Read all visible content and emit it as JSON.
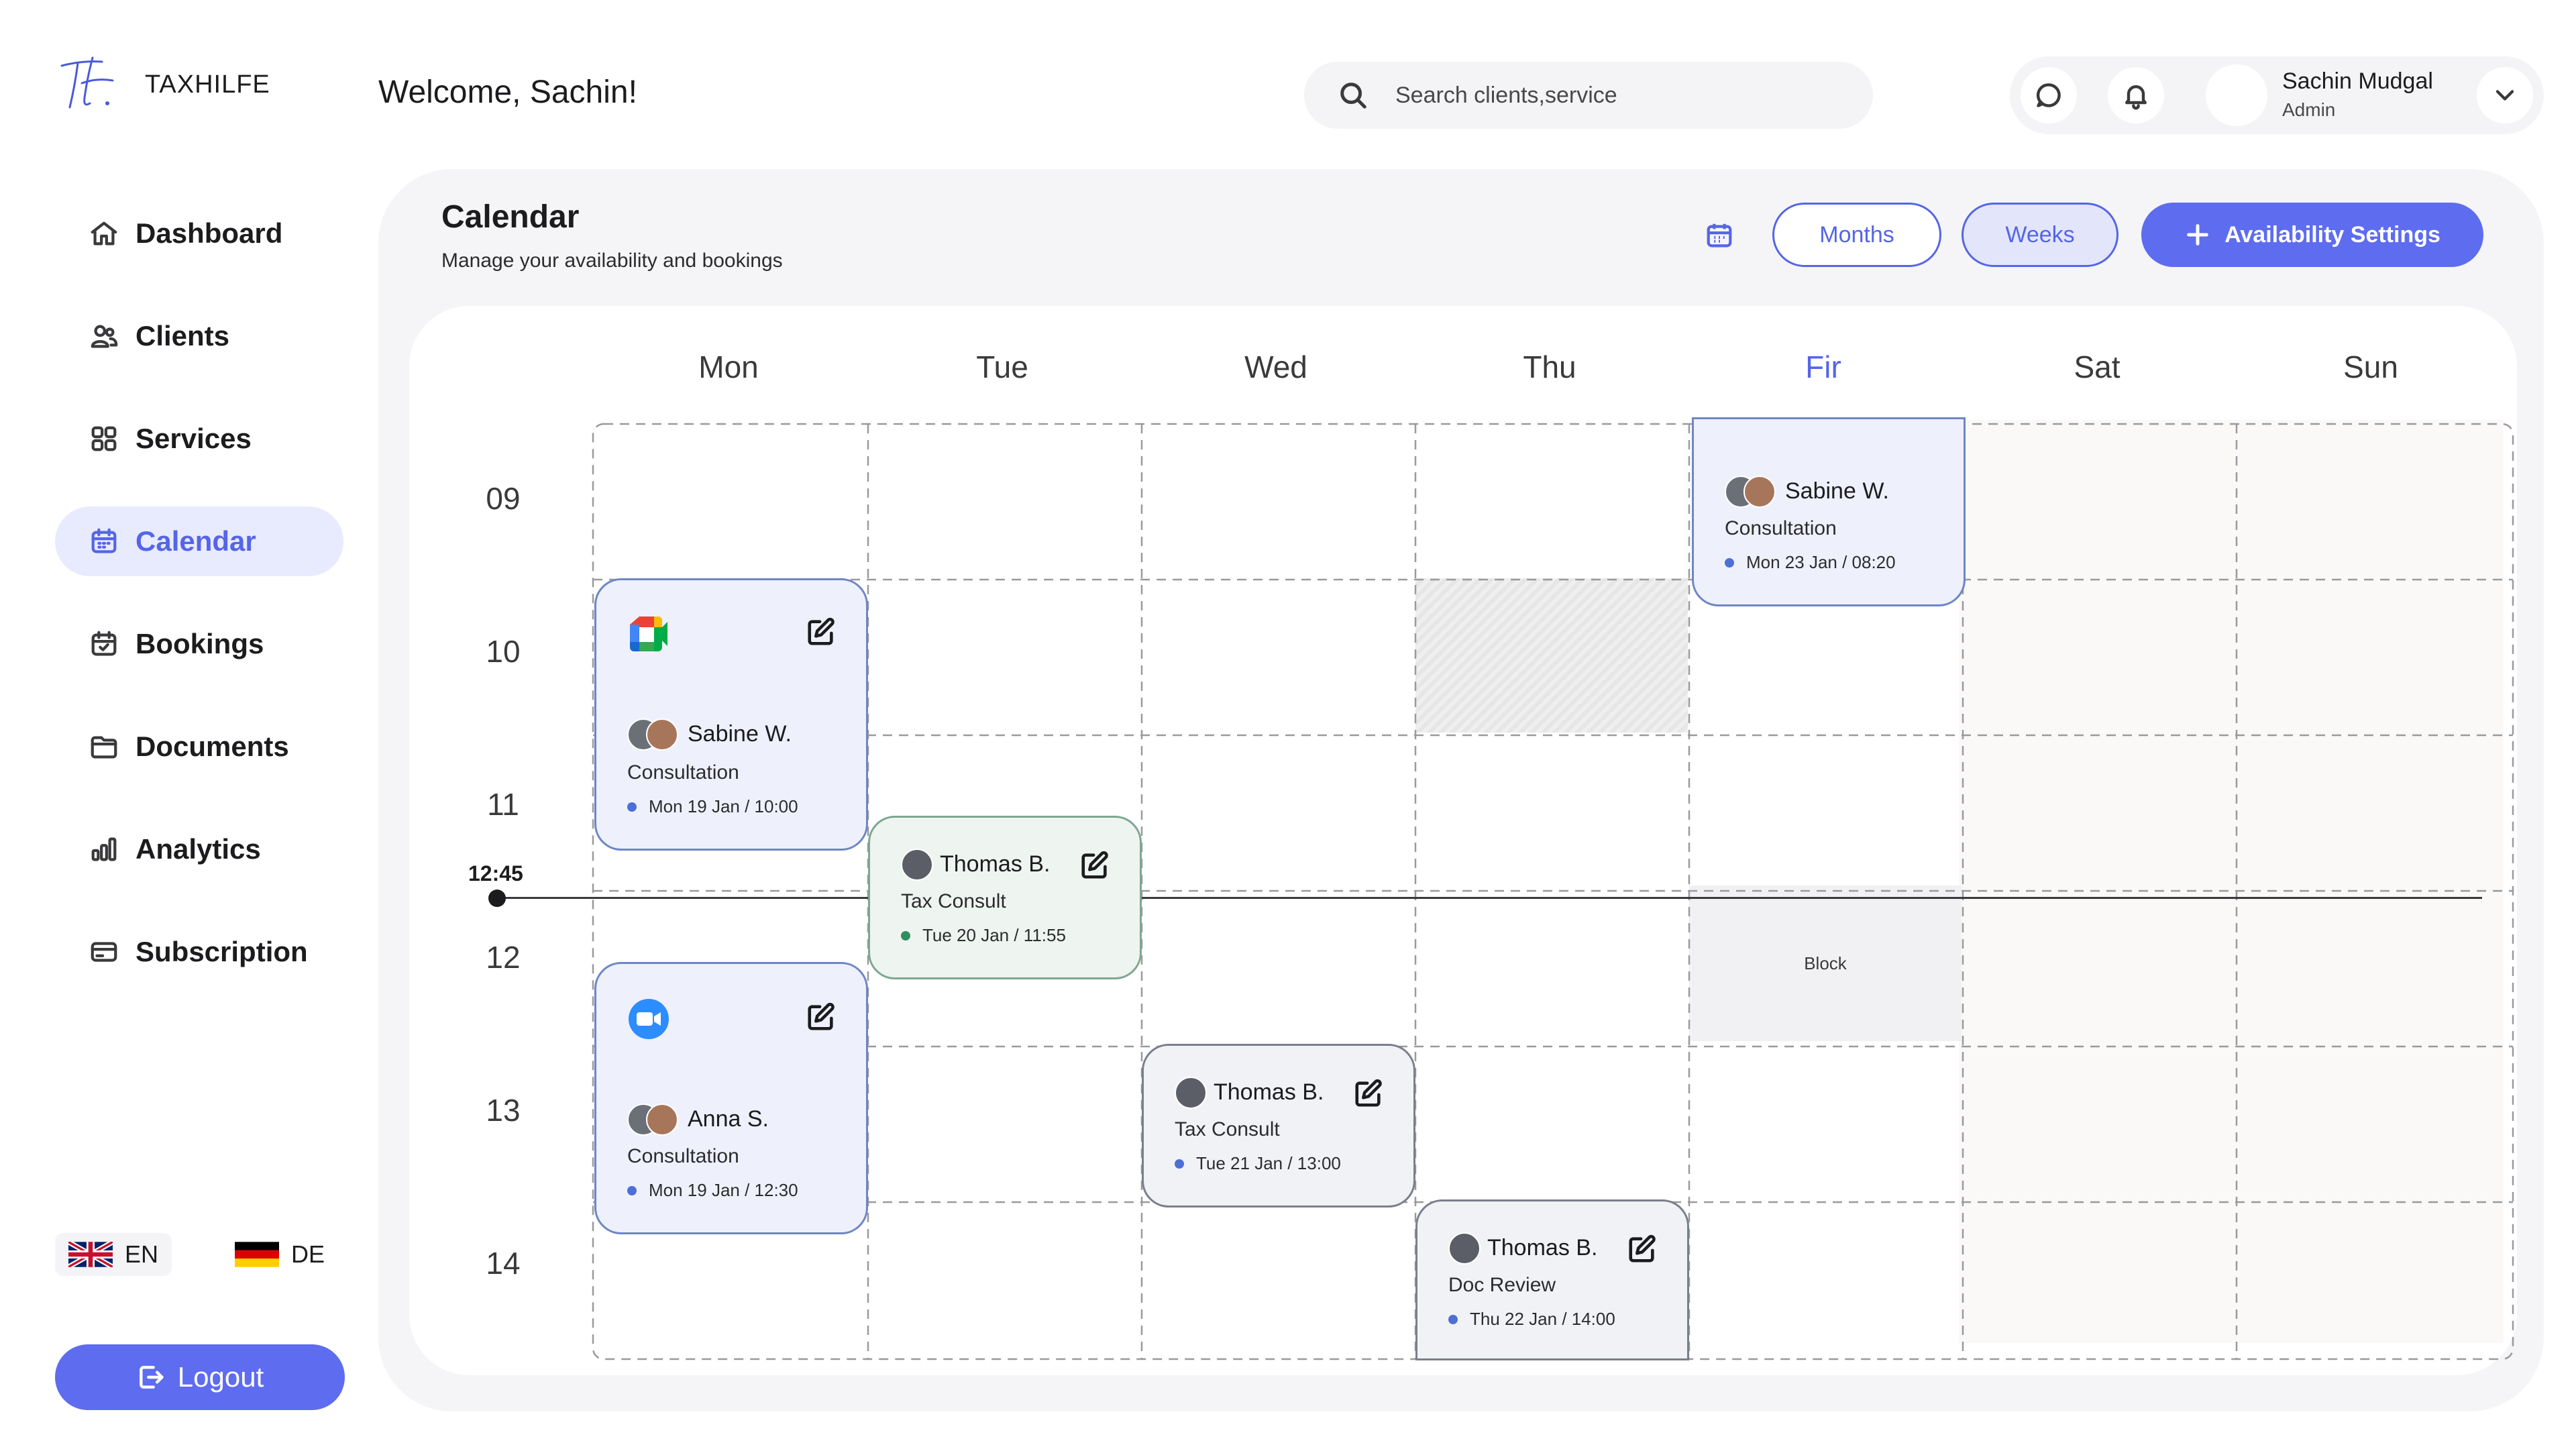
{
  "brand": {
    "name": "TAXHILFE"
  },
  "header": {
    "welcome": "Welcome, Sachin!",
    "search_placeholder": "Search clients,service",
    "user_name": "Sachin Mudgal",
    "user_role": "Admin"
  },
  "sidebar": {
    "items": [
      {
        "label": "Dashboard",
        "icon": "home-icon"
      },
      {
        "label": "Clients",
        "icon": "users-icon"
      },
      {
        "label": "Services",
        "icon": "grid-icon"
      },
      {
        "label": "Calendar",
        "icon": "calendar-icon",
        "active": true
      },
      {
        "label": "Bookings",
        "icon": "calendar-check-icon"
      },
      {
        "label": "Documents",
        "icon": "folder-icon"
      },
      {
        "label": "Analytics",
        "icon": "bar-chart-icon"
      },
      {
        "label": "Subscription",
        "icon": "credit-card-icon"
      }
    ],
    "languages": [
      {
        "code": "EN",
        "active": true
      },
      {
        "code": "DE",
        "active": false
      }
    ],
    "logout_label": "Logout"
  },
  "calendar": {
    "title": "Calendar",
    "subtitle": "Manage your availability and bookings",
    "view_months": "Months",
    "view_weeks": "Weeks",
    "availability_label": "Availability Settings",
    "days": [
      "Mon",
      "Tue",
      "Wed",
      "Thu",
      "Fir",
      "Sat",
      "Sun"
    ],
    "today_index": 4,
    "hours": [
      "09",
      "10",
      "11",
      "12",
      "13",
      "14"
    ],
    "now_time": "12:45",
    "block_label": "Block",
    "events": [
      {
        "name": "Sabine W.",
        "type": "Consultation",
        "time": "Mon 23 Jan / 08:20"
      },
      {
        "name": "Sabine W.",
        "type": "Consultation",
        "time": "Mon 19 Jan / 10:00",
        "app": "google-meet-icon"
      },
      {
        "name": "Thomas B.",
        "type": "Tax Consult",
        "time": "Tue 20 Jan / 11:55"
      },
      {
        "name": "Anna S.",
        "type": "Consultation",
        "time": "Mon 19 Jan / 12:30",
        "app": "zoom-icon"
      },
      {
        "name": "Thomas B.",
        "type": "Tax Consult",
        "time": "Tue 21 Jan / 13:00"
      },
      {
        "name": "Thomas B.",
        "type": "Doc Review",
        "time": "Thu 22 Jan / 14:00"
      }
    ]
  },
  "colors": {
    "accent": "#5e6cf0",
    "accent_text": "#5565e8",
    "active_nav_bg": "#e8ebfd"
  }
}
